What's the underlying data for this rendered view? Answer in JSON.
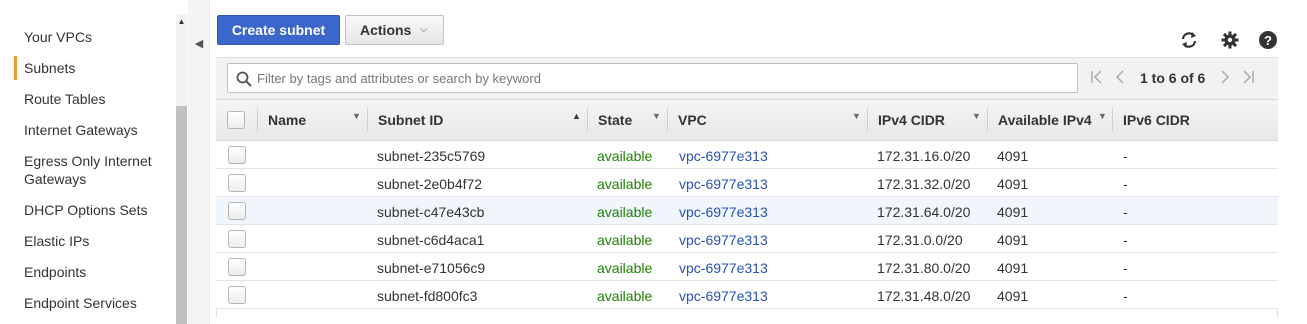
{
  "sidebar": {
    "items": [
      {
        "label": "Your VPCs",
        "active": false
      },
      {
        "label": "Subnets",
        "active": true
      },
      {
        "label": "Route Tables",
        "active": false
      },
      {
        "label": "Internet Gateways",
        "active": false
      },
      {
        "label": "Egress Only Internet",
        "label2": "Gateways",
        "active": false
      },
      {
        "label": "DHCP Options Sets",
        "active": false
      },
      {
        "label": "Elastic IPs",
        "active": false
      },
      {
        "label": "Endpoints",
        "active": false
      },
      {
        "label": "Endpoint Services",
        "active": false
      }
    ],
    "accent_color": "#ec9b2c"
  },
  "toolbar": {
    "create_label": "Create subnet",
    "actions_label": "Actions",
    "icons": [
      "refresh-icon",
      "gear-icon",
      "help-icon"
    ]
  },
  "filter": {
    "placeholder": "Filter by tags and attributes or search by keyword",
    "pager_text": "1 to 6 of 6"
  },
  "table": {
    "columns": [
      "Name",
      "Subnet ID",
      "State",
      "VPC",
      "IPv4 CIDR",
      "Available IPv4",
      "IPv6 CIDR"
    ],
    "sorted_column": "Subnet ID",
    "rows": [
      {
        "name": "",
        "subnet_id": "subnet-235c5769",
        "state": "available",
        "vpc": "vpc-6977e313",
        "ipv4": "172.31.16.0/20",
        "avail": "4091",
        "ipv6": "-"
      },
      {
        "name": "",
        "subnet_id": "subnet-2e0b4f72",
        "state": "available",
        "vpc": "vpc-6977e313",
        "ipv4": "172.31.32.0/20",
        "avail": "4091",
        "ipv6": "-"
      },
      {
        "name": "",
        "subnet_id": "subnet-c47e43cb",
        "state": "available",
        "vpc": "vpc-6977e313",
        "ipv4": "172.31.64.0/20",
        "avail": "4091",
        "ipv6": "-"
      },
      {
        "name": "",
        "subnet_id": "subnet-c6d4aca1",
        "state": "available",
        "vpc": "vpc-6977e313",
        "ipv4": "172.31.0.0/20",
        "avail": "4091",
        "ipv6": "-"
      },
      {
        "name": "",
        "subnet_id": "subnet-e71056c9",
        "state": "available",
        "vpc": "vpc-6977e313",
        "ipv4": "172.31.80.0/20",
        "avail": "4091",
        "ipv6": "-"
      },
      {
        "name": "",
        "subnet_id": "subnet-fd800fc3",
        "state": "available",
        "vpc": "vpc-6977e313",
        "ipv4": "172.31.48.0/20",
        "avail": "4091",
        "ipv6": "-"
      }
    ],
    "highlighted_row": 2
  },
  "colors": {
    "primary_button": "#3b66cc",
    "state_available": "#1d8102",
    "link": "#2851b9"
  }
}
